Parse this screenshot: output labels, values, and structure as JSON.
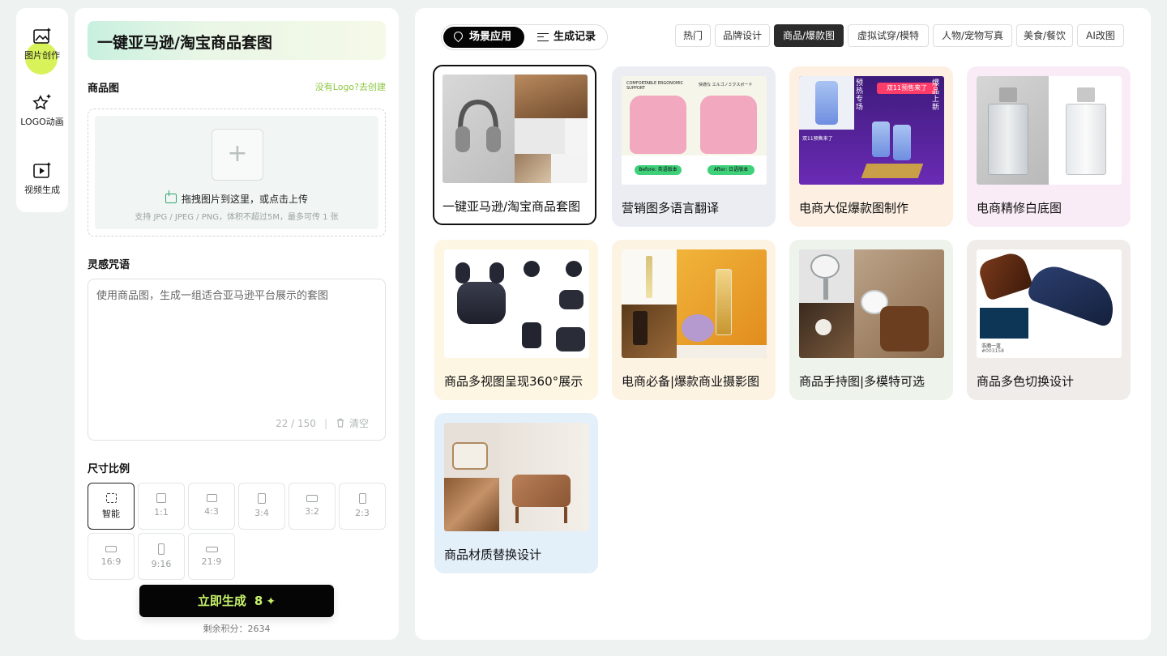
{
  "rail": {
    "items": [
      {
        "label": "图片创作",
        "active": true
      },
      {
        "label": "LOGO动画",
        "active": false
      },
      {
        "label": "视频生成",
        "active": false
      }
    ]
  },
  "panel": {
    "title": "一键亚马逊/淘宝商品套图",
    "product_section": "商品图",
    "logo_link": "没有Logo?去创建",
    "upload_hint": "拖拽图片到这里，或点击上传",
    "upload_sub": "支持 JPG / JPEG / PNG，体积不超过5M，最多可传 1 张",
    "prompt_section": "灵感咒语",
    "prompt_value": "使用商品图，生成一组适合亚马逊平台展示的套图",
    "prompt_counter": "22 / 150",
    "clear_label": "清空",
    "ratio_section": "尺寸比例",
    "ratios": [
      "智能",
      "1:1",
      "4:3",
      "3:4",
      "3:2",
      "2:3",
      "16:9",
      "9:16",
      "21:9"
    ],
    "generate_label": "立即生成",
    "generate_cost": "8",
    "credits": "剩余积分：2634"
  },
  "main": {
    "seg_scene": "场景应用",
    "seg_history": "生成记录",
    "tags": [
      "热门",
      "品牌设计",
      "商品/爆款图",
      "虚拟试穿/模特",
      "人物/宠物写真",
      "美食/餐饮",
      "AI改图"
    ],
    "active_tag": "商品/爆款图",
    "cards": [
      {
        "caption": "一键亚马逊/淘宝商品套图",
        "bg": "#ffffff"
      },
      {
        "caption": "营销图多语言翻译",
        "bg": "#ecedf3"
      },
      {
        "caption": "电商大促爆款图制作",
        "bg": "#fdf0e2"
      },
      {
        "caption": "电商精修白底图",
        "bg": "#f9ecf6"
      },
      {
        "caption": "商品多视图呈现360°展示",
        "bg": "#fdf6e2"
      },
      {
        "caption": "电商必备|爆款商业摄影图",
        "bg": "#fdf3e3"
      },
      {
        "caption": "商品手持图|多模特可选",
        "bg": "#eef4ec"
      },
      {
        "caption": "商品多色切换设计",
        "bg": "#f0ecea"
      },
      {
        "caption": "商品材质替换设计",
        "bg": "#e3f0fa"
      }
    ],
    "thumb_texts": {
      "bag_banner": "COMFORTABLE ERGONOMIC SUPPORT",
      "bag_banner_jp": "快適な エルゴノミクスボード",
      "before": "Before: 英语版本",
      "after": "After: 日语版本",
      "promo": "双11预售来了",
      "promo_left": "预热专场",
      "promo_right": "爆品上新",
      "promo_bottom": "双11预售来了",
      "swatch_name": "浩瀚一蓝",
      "swatch_code": "#003158"
    }
  }
}
